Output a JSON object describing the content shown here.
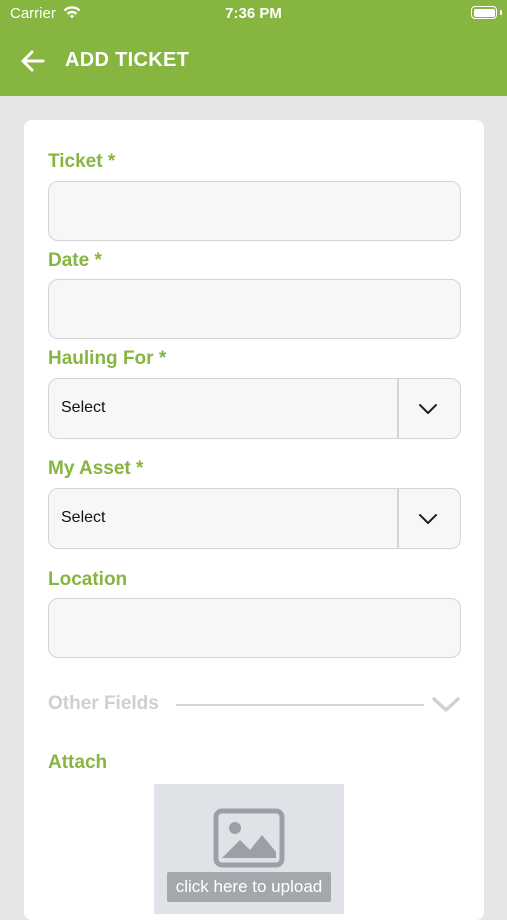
{
  "status_bar": {
    "carrier": "Carrier",
    "time": "7:36 PM"
  },
  "header": {
    "title": "ADD TICKET",
    "back_icon": "arrow-left-icon"
  },
  "form": {
    "ticket_label": "Ticket *",
    "ticket_value": "",
    "date_label": "Date *",
    "date_value": "",
    "hauling_for_label": "Hauling For *",
    "hauling_for_value": "Select",
    "my_asset_label": "My Asset *",
    "my_asset_value": "Select",
    "location_label": "Location",
    "location_value": "",
    "other_fields_label": "Other Fields",
    "attach_label": "Attach",
    "upload_text": "click here to upload"
  },
  "colors": {
    "accent": "#86b540",
    "background": "#e6e6e6",
    "field_bg": "#f7f7f7"
  }
}
